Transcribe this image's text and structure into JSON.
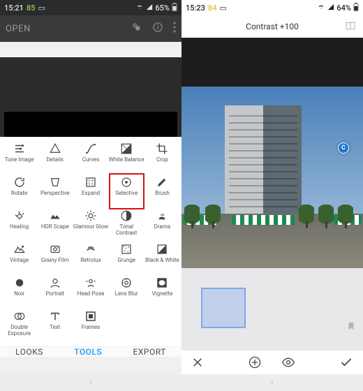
{
  "left": {
    "status": {
      "time": "15:21",
      "pct": "85",
      "battery": "65%"
    },
    "appbar": {
      "open": "OPEN"
    },
    "tools": [
      {
        "id": "tune-image",
        "label": "Tune Image"
      },
      {
        "id": "details",
        "label": "Details"
      },
      {
        "id": "curves",
        "label": "Curves"
      },
      {
        "id": "white-balance",
        "label": "White Balance"
      },
      {
        "id": "crop",
        "label": "Crop"
      },
      {
        "id": "rotate",
        "label": "Rotate"
      },
      {
        "id": "perspective",
        "label": "Perspective"
      },
      {
        "id": "expand",
        "label": "Expand"
      },
      {
        "id": "selective",
        "label": "Selective",
        "highlight": true
      },
      {
        "id": "brush",
        "label": "Brush"
      },
      {
        "id": "healing",
        "label": "Healing"
      },
      {
        "id": "hdr-scape",
        "label": "HDR Scape"
      },
      {
        "id": "glamour-glow",
        "label": "Glamour Glow"
      },
      {
        "id": "tonal-contrast",
        "label": "Tonal Contrast"
      },
      {
        "id": "drama",
        "label": "Drama"
      },
      {
        "id": "vintage",
        "label": "Vintage"
      },
      {
        "id": "grainy-film",
        "label": "Grainy Film"
      },
      {
        "id": "retrolux",
        "label": "Retrolux"
      },
      {
        "id": "grunge",
        "label": "Grunge"
      },
      {
        "id": "black-white",
        "label": "Black & White"
      },
      {
        "id": "noir",
        "label": "Noir"
      },
      {
        "id": "portrait",
        "label": "Portrait"
      },
      {
        "id": "head-pose",
        "label": "Head Pose"
      },
      {
        "id": "lens-blur",
        "label": "Lens Blur"
      },
      {
        "id": "vignette",
        "label": "Vignette"
      },
      {
        "id": "double-exposure",
        "label": "Double Exposure"
      },
      {
        "id": "text",
        "label": "Text"
      },
      {
        "id": "frames",
        "label": "Frames"
      }
    ],
    "tabs": {
      "looks": "LOOKS",
      "tools": "TOOLS",
      "export": "EXPORT",
      "active": "tools"
    }
  },
  "right": {
    "status": {
      "time": "15:23",
      "pct": "84",
      "battery": "64%"
    },
    "title": "Contrast +100",
    "marker": "C"
  }
}
